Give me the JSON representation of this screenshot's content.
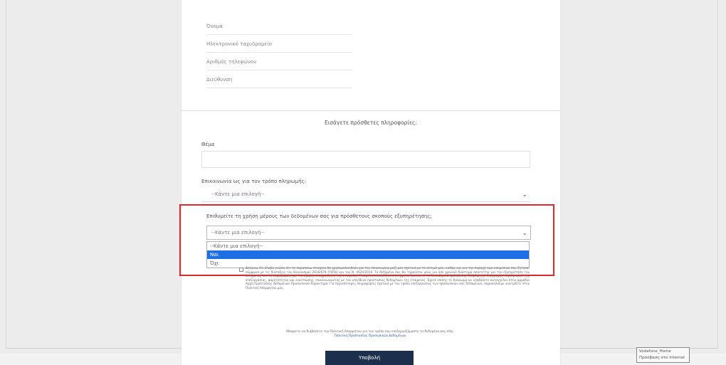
{
  "top_fields": [
    "Όνομα",
    "Ηλεκτρονικό ταχυδρομείο",
    "Αριθμός τηλεφώνου",
    "Διεύθυνση"
  ],
  "section_title": "Εισάγετε πρόσθετες πληροφορίες:",
  "name_label": "Θέμα",
  "name_value": "",
  "payment_label": "Επικοινωνία ως για τον τρόπο πληρωμής:",
  "payment_select": "--Κάντε μια επιλογή--",
  "consent_label": "Επιθυμείτε τη χρήση μέρους των δεδομένων σας για πρόσθετους σκοπούς εξυπηρέτησης;",
  "consent_select": "--Κάντε μια επιλογή--",
  "consent_options": [
    "--Κάντε μια επιλογή--",
    "Ναι",
    "Όχι"
  ],
  "consent_selected_index": 1,
  "consent_text": "Δηλώνω ότι έλαβα γνώση ότι τα παραπάνω στοιχεία θα χρησιμοποιηθούν για την επικοινωνία μαζί μου σχετικά με το αίτημά μου, καθώς και για την παροχή των υπηρεσιών που ζήτησα, σύμφωνα με τις διατάξεις του Κανονισμού 2016/679 (ΓΚΠΔ) και του Ν. 4624/2019. Τα δεδομένα σας θα τηρούνται μόνο για όσο χρονικό διάστημα απαιτείται για την εξυπηρέτηση του αιτήματος και τη συμμόρφωση με τις νόμιμες υποχρεώσεις της εταιρείας. Μπορείτε οποιαδήποτε στιγμή να ασκήσετε τα δικαιώματα πρόσβασης, διόρθωσης, διαγραφής, περιορισμού της επεξεργασίας, φορητότητας και εναντίωσης, επικοινωνώντας με τον υπεύθυνο προστασίας δεδομένων της εταιρείας. Έχετε επίσης το δικαίωμα να υποβάλετε καταγγελία στην αρμόδια Αρχή Προστασίας Δεδομένων Προσωπικού Χαρακτήρα. Για περισσότερες πληροφορίες σχετικά με τον τρόπο επεξεργασίας των προσωπικών σας δεδομένων, παρακαλούμε ανατρέξτε στην Πολιτική Απορρήτου μας.",
  "footnote_text": "Μπορείτε να διαβάσετε την Πολιτική Απορρήτου για τον τρόπο που επεξεργαζόμαστε τα δεδομένα σας εδώ:",
  "footnote_link": "Πολιτική Προστασίας Προσωπικών Δεδομένων",
  "submit_label": "Υποβολή",
  "tooltip_line1": "Vodafone_Home",
  "tooltip_line2": "Πρόσβαση στο Internet",
  "colors": {
    "accent_border": "#e0262e",
    "selected_option": "#1e6ee6",
    "submit_bg": "#1c2f4d"
  }
}
